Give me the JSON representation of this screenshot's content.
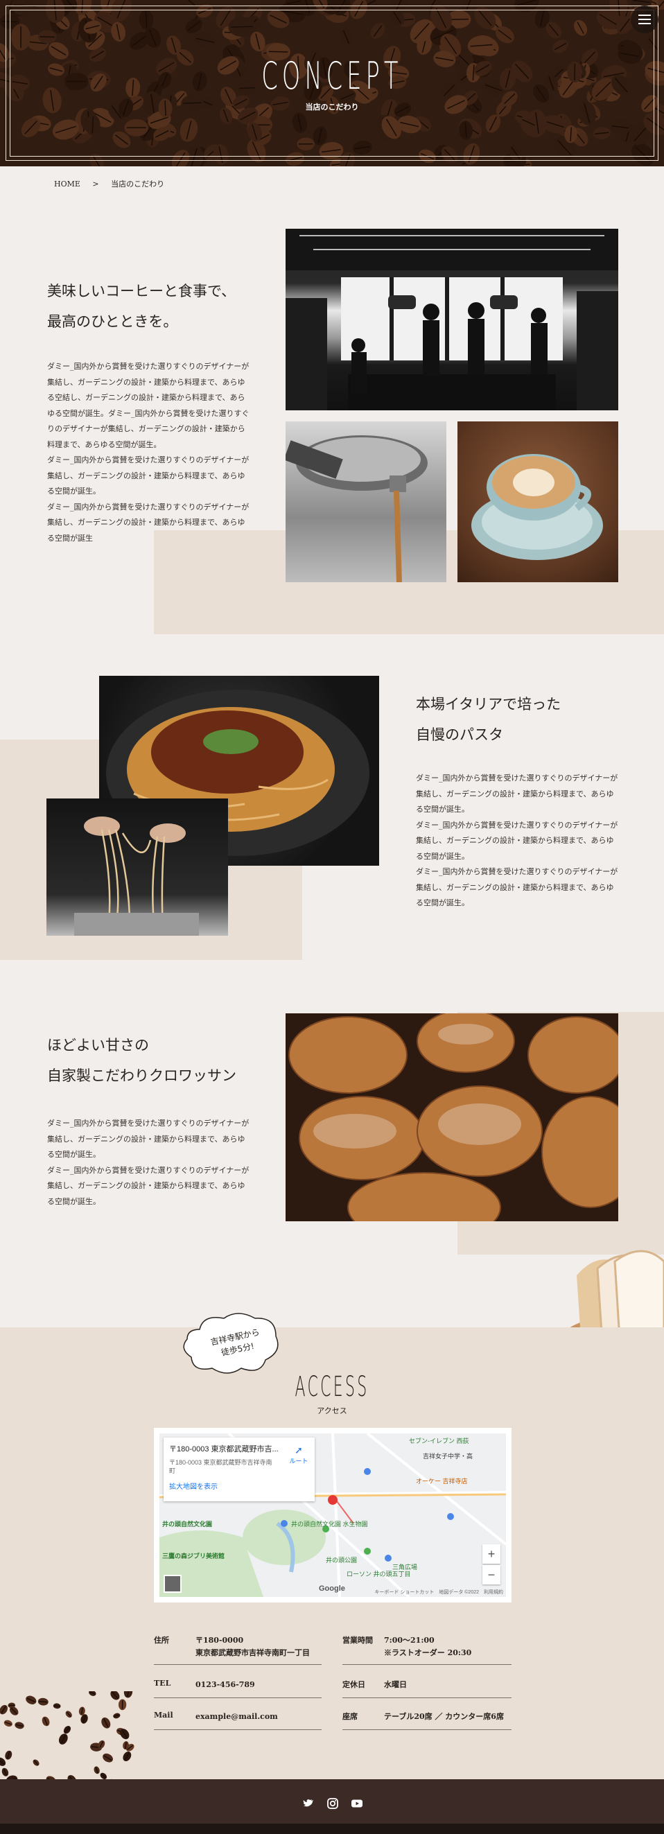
{
  "hero": {
    "title": "CONCEPT",
    "subtitle": "当店のこだわり"
  },
  "breadcrumb": {
    "home": "HOME",
    "separator": ">",
    "current": "当店のこだわり"
  },
  "sections": [
    {
      "title_line1": "美味しいコーヒーと食事で、",
      "title_line2": "最高のひとときを。",
      "paragraphs": [
        "ダミー_国内外から賞賛を受けた選りすぐりのデザイナーが集結し、ガーデニングの設計・建築から料理まで、あらゆる空結し、ガーデニングの設計・建築から料理まで、あらゆる空間が誕生。ダミー_国内外から賞賛を受けた選りすぐりのデザイナーが集結し、ガーデニングの設計・建築から料理まで、あらゆる空間が誕生。",
        "ダミー_国内外から賞賛を受けた選りすぐりのデザイナーが集結し、ガーデニングの設計・建築から料理まで、あらゆる空間が誕生。",
        "ダミー_国内外から賞賛を受けた選りすぐりのデザイナーが集結し、ガーデニングの設計・建築から料理まで、あらゆる空間が誕生"
      ]
    },
    {
      "title_line1": "本場イタリアで培った",
      "title_line2": "自慢のパスタ",
      "paragraphs": [
        "ダミー_国内外から賞賛を受けた選りすぐりのデザイナーが集結し、ガーデニングの設計・建築から料理まで、あらゆる空間が誕生。",
        "ダミー_国内外から賞賛を受けた選りすぐりのデザイナーが集結し、ガーデニングの設計・建築から料理まで、あらゆる空間が誕生。",
        "ダミー_国内外から賞賛を受けた選りすぐりのデザイナーが集結し、ガーデニングの設計・建築から料理まで、あらゆる空間が誕生。"
      ]
    },
    {
      "title_line1": "ほどよい甘さの",
      "title_line2": "自家製こだわりクロワッサン",
      "paragraphs": [
        "ダミー_国内外から賞賛を受けた選りすぐりのデザイナーが集結し、ガーデニングの設計・建築から料理まで、あらゆる空間が誕生。",
        "ダミー_国内外から賞賛を受けた選りすぐりのデザイナーが集結し、ガーデニングの設計・建築から料理まで、あらゆる空間が誕生。"
      ]
    }
  ],
  "access": {
    "title": "ACCESS",
    "subtitle": "アクセス",
    "bubble_line1": "吉祥寺駅から",
    "bubble_line2": "徒歩5分!",
    "map": {
      "card_title": "〒180-0003 東京都武蔵野市吉...",
      "card_address": "〒180-0003 東京都武蔵野市吉祥寺南町",
      "card_link": "拡大地図を表示",
      "route": "ルート",
      "zoom_in": "+",
      "zoom_out": "−",
      "google": "Google",
      "footer": "キーボード ショートカット　地図データ ©2022　利用規約",
      "labels": [
        "セブン-イレブン 西荻",
        "吉祥女子中学・高",
        "オーケー 吉祥寺店",
        "井の頭自然文化園",
        "井の頭自然文化園 水生物園",
        "三鷹の森ジブリ美術館",
        "井の頭公園",
        "ローソン 井の頭五丁目",
        "三角広場"
      ]
    },
    "info": [
      {
        "key": "住所",
        "value_line1": "〒180-0000",
        "value_line2": "東京都武蔵野市吉祥寺南町一丁目"
      },
      {
        "key": "営業時間",
        "value_line1": "7:00～21:00",
        "value_line2": "※ラストオーダー 20:30"
      },
      {
        "key": "TEL",
        "value_line1": "0123-456-789",
        "value_line2": ""
      },
      {
        "key": "定休日",
        "value_line1": "水曜日",
        "value_line2": ""
      },
      {
        "key": "Mail",
        "value_line1": "example@mail.com",
        "value_line2": ""
      },
      {
        "key": "座席",
        "value_line1": "テーブル20席 ／ カウンター席6席",
        "value_line2": ""
      }
    ]
  },
  "footer": {
    "icons": [
      "twitter-icon",
      "instagram-icon",
      "youtube-icon"
    ]
  },
  "colors": {
    "beige": "#e9dfd5",
    "background": "#f2eeeb",
    "footer": "#3b2a25"
  }
}
